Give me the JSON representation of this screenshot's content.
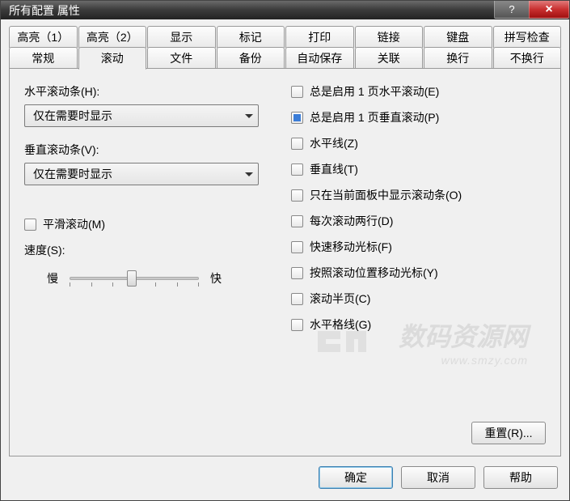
{
  "window": {
    "title": "所有配置 属性"
  },
  "titlebar_buttons": {
    "help_label": "?",
    "close_label": "×"
  },
  "tabs_row1": [
    {
      "label": "高亮（1）"
    },
    {
      "label": "高亮（2）"
    },
    {
      "label": "显示"
    },
    {
      "label": "标记"
    },
    {
      "label": "打印"
    },
    {
      "label": "链接"
    },
    {
      "label": "键盘"
    },
    {
      "label": "拼写检查"
    }
  ],
  "tabs_row2": [
    {
      "label": "常规"
    },
    {
      "label": "滚动",
      "active": true
    },
    {
      "label": "文件"
    },
    {
      "label": "备份"
    },
    {
      "label": "自动保存"
    },
    {
      "label": "关联"
    },
    {
      "label": "换行"
    },
    {
      "label": "不换行"
    }
  ],
  "left": {
    "h_label": "水平滚动条(H):",
    "h_value": "仅在需要时显示",
    "v_label": "垂直滚动条(V):",
    "v_value": "仅在需要时显示",
    "smooth_label": "平滑滚动(M)",
    "speed_label": "速度(S):",
    "slow": "慢",
    "fast": "快"
  },
  "right_checks": [
    {
      "label": "总是启用 1 页水平滚动(E)",
      "checked": false
    },
    {
      "label": "总是启用 1 页垂直滚动(P)",
      "checked": true
    },
    {
      "label": "水平线(Z)",
      "checked": false
    },
    {
      "label": "垂直线(T)",
      "checked": false
    },
    {
      "label": "只在当前面板中显示滚动条(O)",
      "checked": false
    },
    {
      "label": "每次滚动两行(D)",
      "checked": false
    },
    {
      "label": "快速移动光标(F)",
      "checked": false
    },
    {
      "label": "按照滚动位置移动光标(Y)",
      "checked": false
    },
    {
      "label": "滚动半页(C)",
      "checked": false
    },
    {
      "label": "水平格线(G)",
      "checked": false
    }
  ],
  "buttons": {
    "reset": "重置(R)...",
    "ok": "确定",
    "cancel": "取消",
    "help": "帮助"
  },
  "watermark": {
    "main": "数码资源网",
    "sub": "www.smzy.com"
  }
}
